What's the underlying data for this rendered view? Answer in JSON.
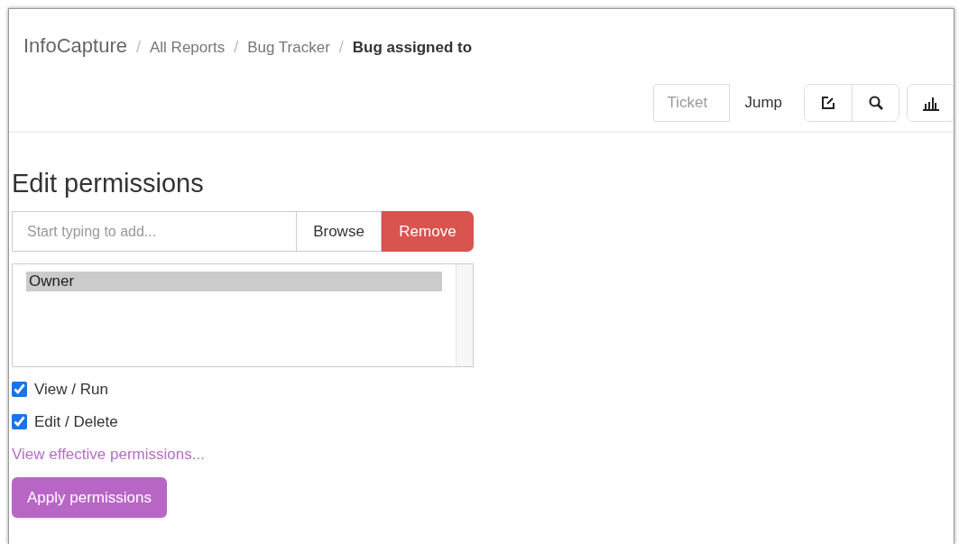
{
  "breadcrumb": [
    {
      "label": "InfoCapture",
      "kind": "brand"
    },
    {
      "separator": "/",
      "label": "All Reports",
      "kind": "link"
    },
    {
      "separator": "/",
      "label": "Bug Tracker",
      "kind": "link"
    },
    {
      "separator": "/",
      "label": "Bug assigned to",
      "kind": "current"
    }
  ],
  "toolbar": {
    "ticket_field": {
      "placeholder": "Ticket"
    },
    "jump_button": "Jump"
  },
  "heading": "Edit permissions",
  "add_field": {
    "placeholder": "Start typing to add..."
  },
  "buttons": {
    "browse": "Browse",
    "remove": "Remove"
  },
  "principals": [
    {
      "label": "Owner",
      "selected": true
    }
  ],
  "permissions": [
    {
      "label": "View / Run",
      "checked": true
    },
    {
      "label": "Edit / Delete",
      "checked": true
    }
  ],
  "effective_link": "View effective permissions...",
  "apply_button": "Apply permissions"
}
